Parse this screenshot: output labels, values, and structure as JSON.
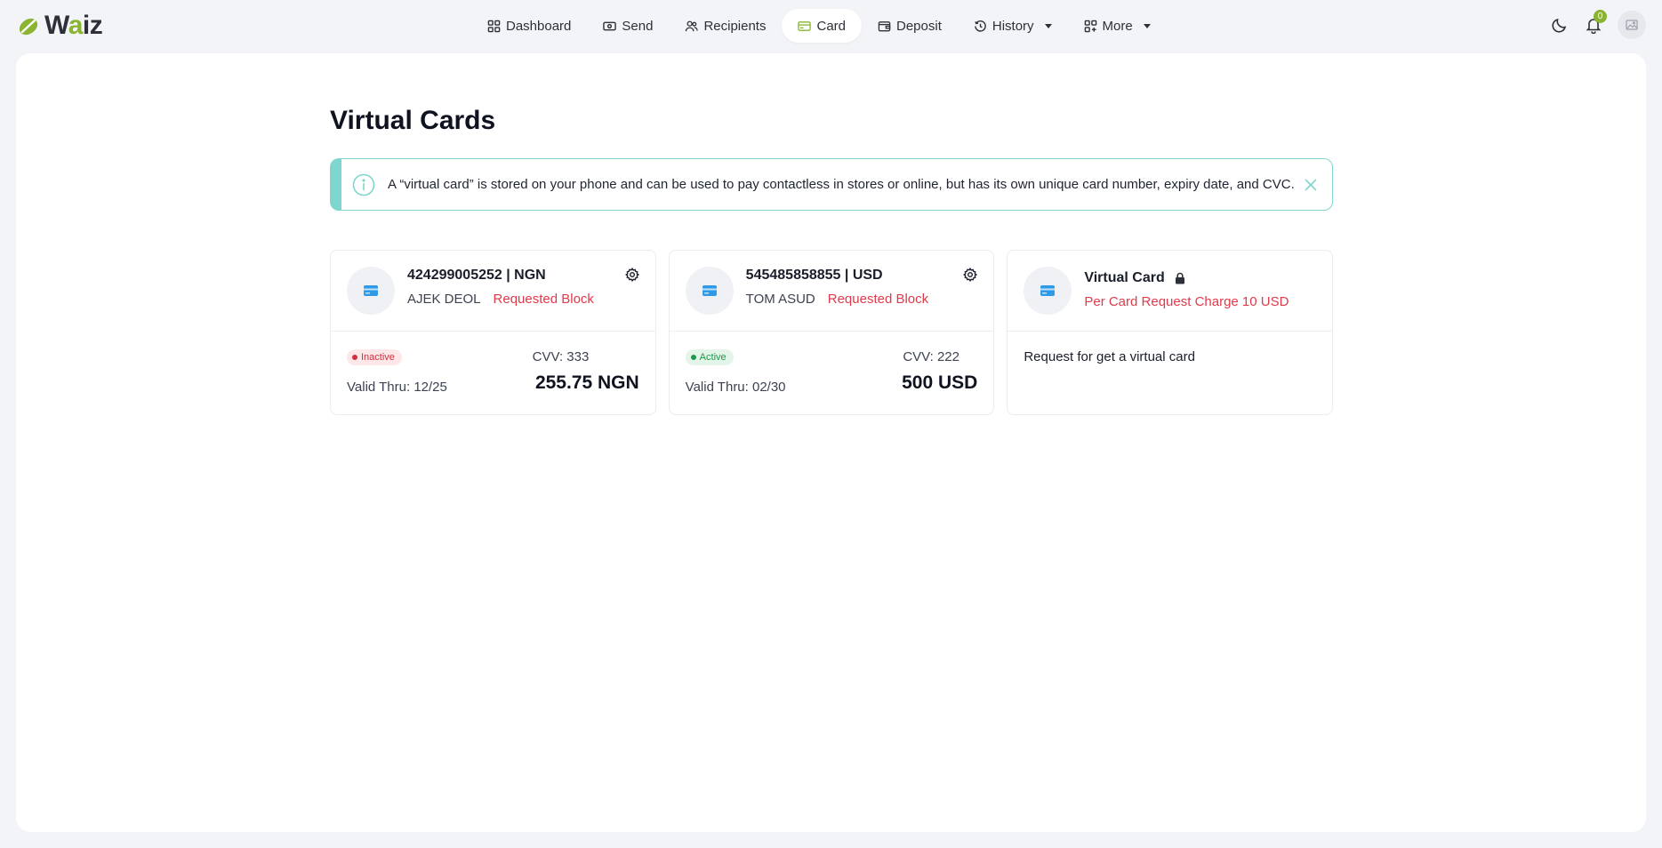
{
  "brand": {
    "name_prefix": "W",
    "name_accent": "a",
    "name_suffix": "iz",
    "accent_color": "#8ab432"
  },
  "nav": {
    "dashboard": "Dashboard",
    "send": "Send",
    "recipients": "Recipients",
    "card": "Card",
    "deposit": "Deposit",
    "history": "History",
    "more": "More"
  },
  "header": {
    "notification_count": "0"
  },
  "page": {
    "title": "Virtual Cards",
    "alert": "A “virtual card” is stored on your phone and can be used to pay contactless in stores or online, but has its own unique card number, expiry date, and CVC."
  },
  "cards": [
    {
      "number": "424299005252 | NGN",
      "holder": "AJEK DEOL",
      "request_status": "Requested Block",
      "status": "Inactive",
      "valid_thru": "Valid Thru: 12/25",
      "cvv": "CVV: 333",
      "amount": "255.75 NGN"
    },
    {
      "number": "545485858855 | USD",
      "holder": "TOM ASUD",
      "request_status": "Requested Block",
      "status": "Active",
      "valid_thru": "Valid Thru: 02/30",
      "cvv": "CVV: 222",
      "amount": "500 USD"
    }
  ],
  "virtual_card": {
    "title": "Virtual Card",
    "charge": "Per Card Request Charge 10 USD",
    "request_label": "Request for get a virtual card"
  }
}
